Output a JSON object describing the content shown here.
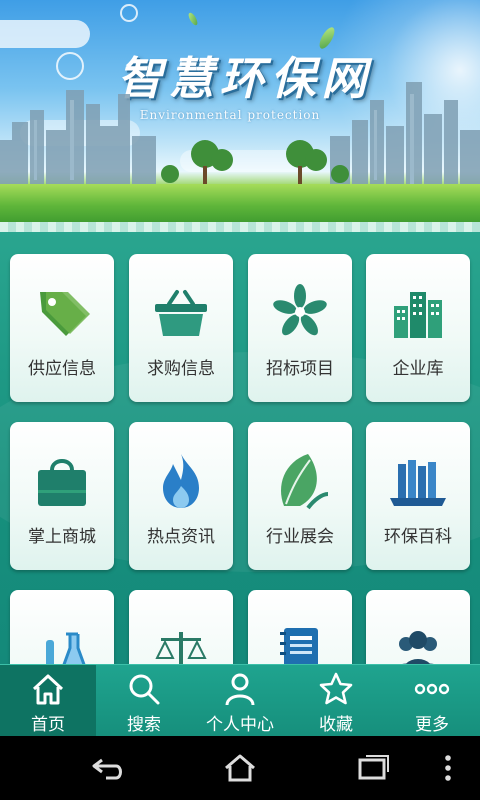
{
  "banner": {
    "title": "智慧环保网",
    "subtitle": "Environmental protection"
  },
  "grid": {
    "items": [
      {
        "label": "供应信息",
        "icon": "price-tag-icon"
      },
      {
        "label": "求购信息",
        "icon": "shopping-basket-icon"
      },
      {
        "label": "招标项目",
        "icon": "flower-icon"
      },
      {
        "label": "企业库",
        "icon": "buildings-icon"
      },
      {
        "label": "掌上商城",
        "icon": "shopping-bag-icon"
      },
      {
        "label": "热点资讯",
        "icon": "flame-icon"
      },
      {
        "label": "行业展会",
        "icon": "leaf-icon"
      },
      {
        "label": "环保百科",
        "icon": "books-icon"
      },
      {
        "label": "",
        "icon": "lab-flask-icon"
      },
      {
        "label": "",
        "icon": "scales-icon"
      },
      {
        "label": "",
        "icon": "notebook-icon"
      },
      {
        "label": "",
        "icon": "people-icon"
      }
    ]
  },
  "tabbar": {
    "tabs": [
      {
        "label": "首页",
        "icon": "home-icon",
        "active": true
      },
      {
        "label": "搜索",
        "icon": "search-icon",
        "active": false
      },
      {
        "label": "个人中心",
        "icon": "user-icon",
        "active": false
      },
      {
        "label": "收藏",
        "icon": "star-icon",
        "active": false
      },
      {
        "label": "更多",
        "icon": "more-dots-icon",
        "active": false
      }
    ]
  },
  "android_nav": {
    "buttons": [
      "back-icon",
      "home-nav-icon",
      "recent-apps-icon",
      "overflow-menu-icon"
    ]
  },
  "colors": {
    "accent": "#1f9a86",
    "icon_green": "#2a8a6f",
    "active_tab": "#0e7362"
  }
}
